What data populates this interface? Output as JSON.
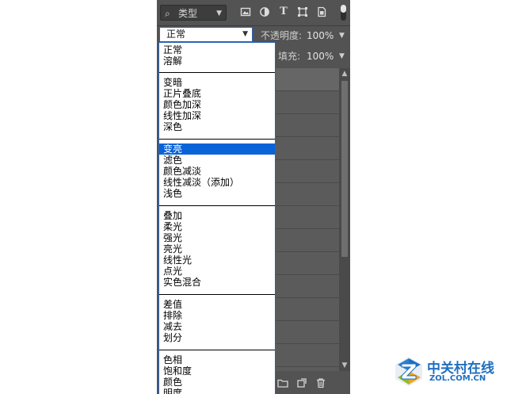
{
  "filter": {
    "kind_label": "类型",
    "icons": [
      "image-filter-icon",
      "adjustment-filter-icon",
      "type-filter-icon",
      "shape-filter-icon",
      "smart-object-filter-icon"
    ]
  },
  "options": {
    "blend_mode": "正常",
    "opacity_label": "不透明度:",
    "opacity_value": "100%",
    "fill_label": "填充:",
    "fill_value": "100%"
  },
  "dropdown": {
    "groups": [
      [
        "正常",
        "溶解"
      ],
      [
        "变暗",
        "正片叠底",
        "颜色加深",
        "线性加深",
        "深色"
      ],
      [
        "变亮",
        "滤色",
        "颜色减淡",
        "线性减淡（添加）",
        "浅色"
      ],
      [
        "叠加",
        "柔光",
        "强光",
        "亮光",
        "线性光",
        "点光",
        "实色混合"
      ],
      [
        "差值",
        "排除",
        "减去",
        "划分"
      ],
      [
        "色相",
        "饱和度",
        "颜色",
        "明度"
      ]
    ],
    "selected": "变亮"
  },
  "watermark": {
    "name": "中关村在线",
    "domain": "ZOL.COM.CN",
    "brand_color": "#1f6fc0"
  },
  "colors": {
    "panel_bg": "#535353",
    "selection": "#0a64d8",
    "focus_border": "#2b63b8"
  }
}
